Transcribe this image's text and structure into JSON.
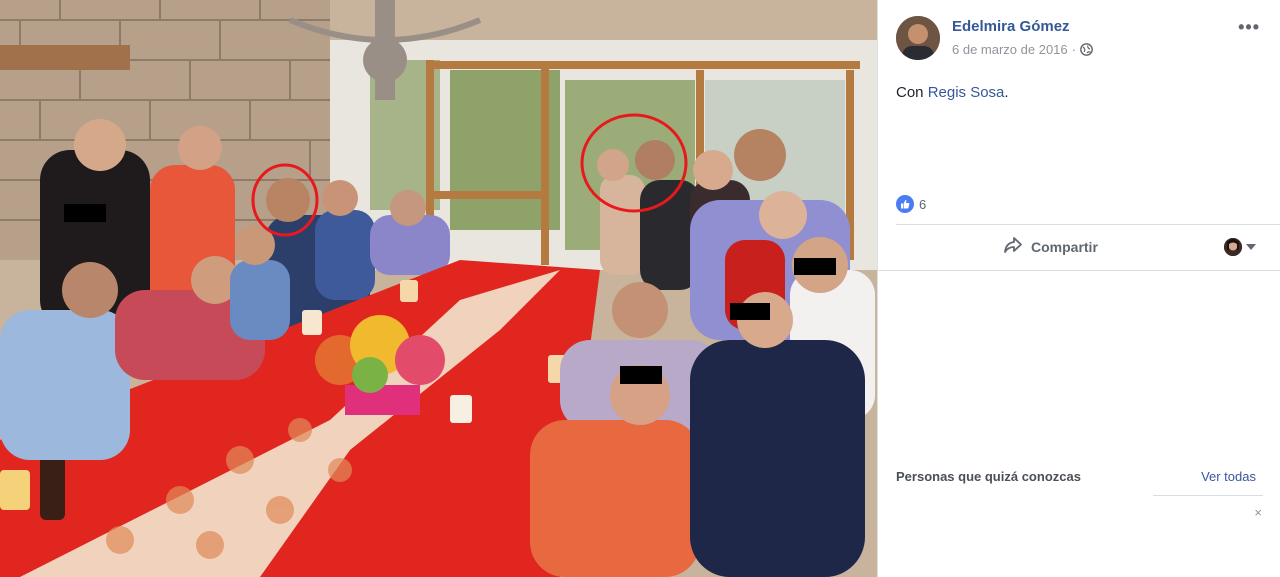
{
  "post": {
    "author": "Edelmira Gómez",
    "date": "6 de marzo de 2016",
    "date_separator": "·",
    "more_label": "•••",
    "caption_prefix": "Con ",
    "tagged_person": "Regis Sosa",
    "caption_suffix": ".",
    "like_count": "6",
    "share_label": "Compartir"
  },
  "suggestions": {
    "title": "Personas que quizá conozcas",
    "see_all": "Ver todas",
    "close_label": "×"
  },
  "icons": {
    "avatar": "avatar",
    "privacy": "globe-icon",
    "like": "thumbs-up-icon",
    "share": "share-arrow-icon",
    "audience": "audience-selector-icon"
  },
  "colors": {
    "link": "#365899",
    "like_blue": "#4b7cf3",
    "secondary_text": "#90949c",
    "highlight_circle": "#e8191c",
    "tablecloth": "#e0261e"
  }
}
